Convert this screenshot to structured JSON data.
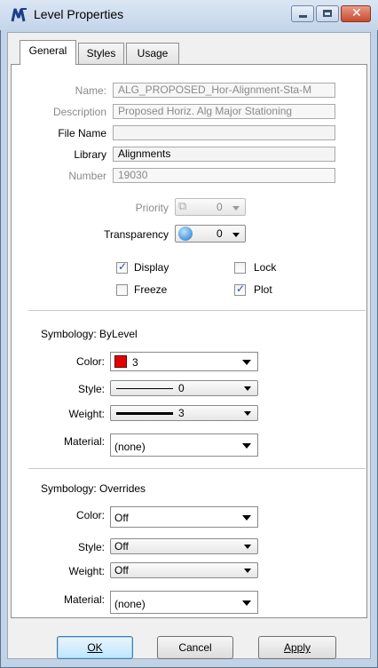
{
  "window": {
    "title": "Level Properties",
    "controls": {
      "minimize": "minimize-icon",
      "maximize": "maximize-icon",
      "close": "close-icon"
    }
  },
  "tabs": [
    {
      "label": "General",
      "active": true
    },
    {
      "label": "Styles",
      "active": false
    },
    {
      "label": "Usage",
      "active": false
    }
  ],
  "general": {
    "name_label": "Name:",
    "name_value": "ALG_PROPOSED_Hor-Alignment-Sta-M",
    "description_label": "Description",
    "description_value": "Proposed Horiz. Alg Major Stationing",
    "file_name_label": "File Name",
    "file_name_value": "",
    "library_label": "Library",
    "library_value": "Alignments",
    "number_label": "Number",
    "number_value": "19030",
    "priority_label": "Priority",
    "priority_value": "0",
    "transparency_label": "Transparency",
    "transparency_value": "0",
    "checkboxes": {
      "display": {
        "label": "Display",
        "checked": true
      },
      "lock": {
        "label": "Lock",
        "checked": false
      },
      "freeze": {
        "label": "Freeze",
        "checked": false
      },
      "plot": {
        "label": "Plot",
        "checked": true
      }
    }
  },
  "symbology_bylevel": {
    "heading": "Symbology: ByLevel",
    "color_label": "Color:",
    "color_value": "3",
    "color_swatch": "#e00000",
    "style_label": "Style:",
    "style_value": "0",
    "weight_label": "Weight:",
    "weight_value": "3",
    "material_label": "Material:",
    "material_value": "(none)"
  },
  "symbology_overrides": {
    "heading": "Symbology: Overrides",
    "color_label": "Color:",
    "color_value": "Off",
    "style_label": "Style:",
    "style_value": "Off",
    "weight_label": "Weight:",
    "weight_value": "Off",
    "material_label": "Material:",
    "material_value": "(none)"
  },
  "buttons": {
    "ok": "OK",
    "cancel": "Cancel",
    "apply": "Apply"
  },
  "colors": {
    "window_frame": "#c3d3e6",
    "default_button": "#bee6fd",
    "close_button": "#c74a30"
  }
}
